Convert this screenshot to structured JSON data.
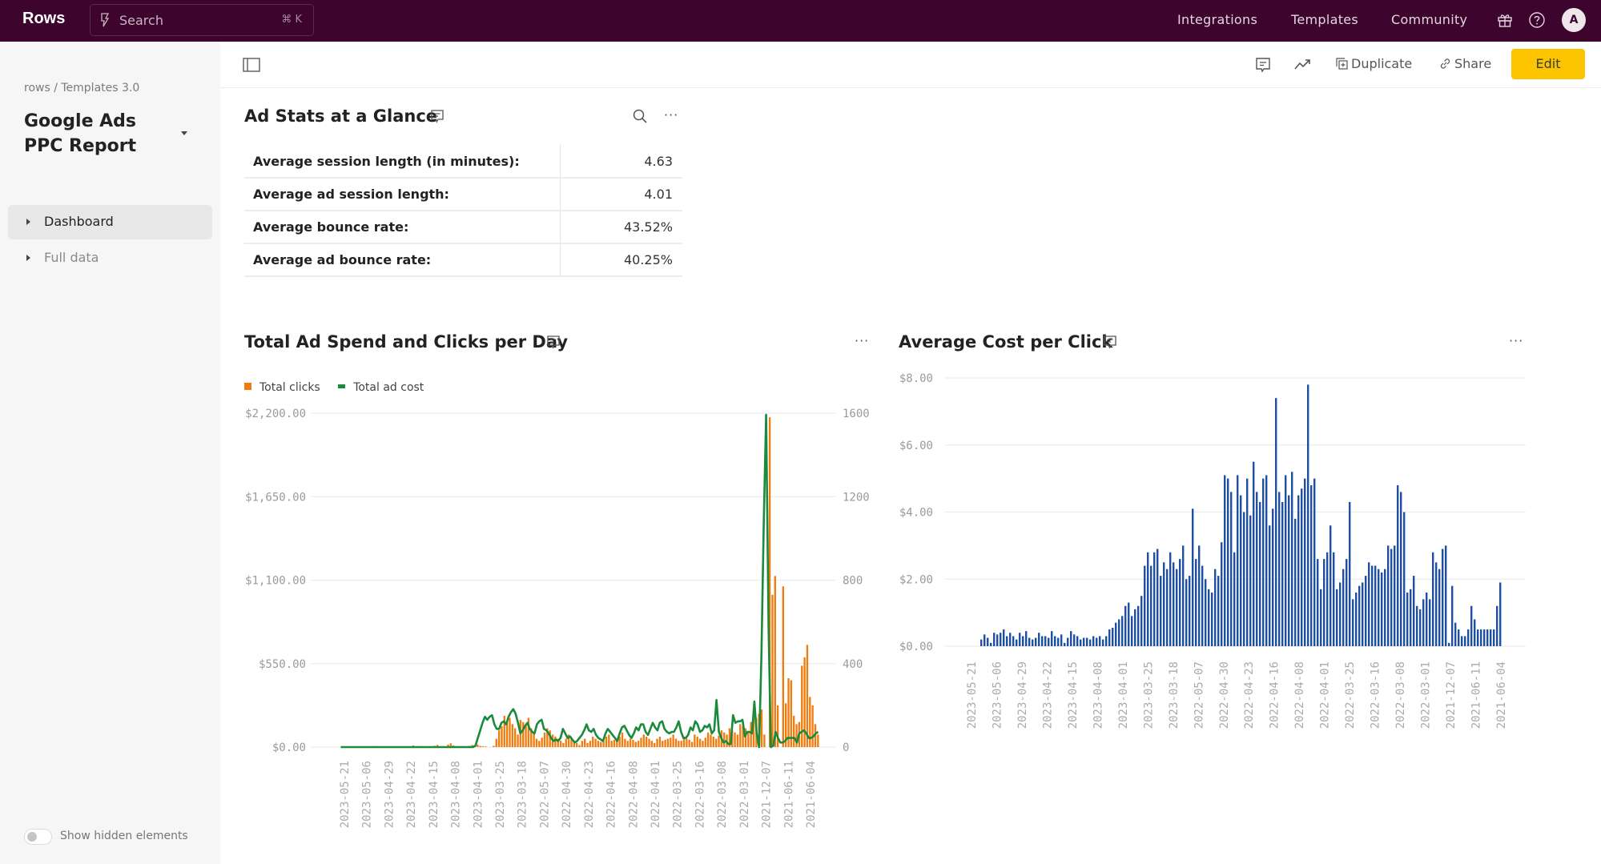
{
  "topbar": {
    "brand": "Rows",
    "search_placeholder": "Search",
    "search_shortcut": "⌘ K",
    "nav": [
      "Integrations",
      "Templates",
      "Community"
    ],
    "icons": [
      "gift-icon",
      "help-icon"
    ],
    "avatar_initial": "A",
    "colors": {
      "background": "#3d052d"
    }
  },
  "sidebar": {
    "breadcrumb": "rows / Templates 3.0",
    "doc_title": "Google Ads PPC Report",
    "items": [
      {
        "label": "Dashboard",
        "active": true
      },
      {
        "label": "Full data",
        "active": false
      }
    ],
    "toggle_label": "Show hidden elements",
    "toggle_on": false
  },
  "toolbar": {
    "duplicate_label": "Duplicate",
    "share_label": "Share",
    "edit_label": "Edit",
    "edit_color": "#fdc500"
  },
  "stats": {
    "title": "Ad Stats at a Glance",
    "rows": [
      {
        "label": "Average session length (in minutes):",
        "value": "4.63"
      },
      {
        "label": "Average ad session length:",
        "value": "4.01"
      },
      {
        "label": "Average bounce rate:",
        "value": "43.52%"
      },
      {
        "label": "Average ad bounce rate:",
        "value": "40.25%"
      }
    ]
  },
  "chart_data": [
    {
      "type": "bar",
      "title": "Total Ad Spend and Clicks per Day",
      "legend_position": "top-left",
      "legend": [
        "Total clicks",
        "Total ad cost"
      ],
      "colors": {
        "Total clicks": "#f07c0f",
        "Total ad cost": "#1a8a3c"
      },
      "y_left": {
        "ticks": [
          "$0.00",
          "$550.00",
          "$1,100.00",
          "$1,650.00",
          "$2,200.00"
        ],
        "range": [
          0,
          2200
        ]
      },
      "y_right": {
        "ticks": [
          "0",
          "400",
          "800",
          "1200",
          "1600"
        ],
        "range": [
          0,
          1600
        ]
      },
      "grid": true,
      "x_tick_labels": [
        "2023-05-21",
        "2023-05-06",
        "2023-04-29",
        "2023-04-22",
        "2023-04-15",
        "2023-04-08",
        "2023-04-01",
        "2023-03-25",
        "2023-03-18",
        "2022-05-07",
        "2022-04-30",
        "2022-04-23",
        "2022-04-16",
        "2022-04-08",
        "2022-04-01",
        "2022-03-25",
        "2022-03-16",
        "2022-03-08",
        "2022-03-01",
        "2021-12-07",
        "2021-06-11",
        "2021-06-04"
      ],
      "series": [
        {
          "name": "Total clicks",
          "kind": "bar",
          "axis": "right",
          "values": [
            0,
            0,
            2,
            1,
            3,
            2,
            1,
            0,
            2,
            3,
            2,
            1,
            4,
            2,
            3,
            2,
            1,
            2,
            3,
            1,
            2,
            0,
            1,
            3,
            2,
            1,
            2,
            8,
            3,
            2,
            4,
            2,
            1,
            3,
            2,
            6,
            10,
            4,
            2,
            3,
            12,
            18,
            8,
            3,
            2,
            5,
            3,
            2,
            6,
            10,
            8,
            12,
            6,
            4,
            3,
            0,
            0,
            6,
            40,
            80,
            100,
            150,
            120,
            140,
            110,
            90,
            60,
            130,
            120,
            110,
            140,
            90,
            70,
            40,
            30,
            45,
            70,
            90,
            80,
            60,
            50,
            40,
            30,
            20,
            40,
            60,
            40,
            30,
            20,
            10,
            30,
            40,
            20,
            30,
            50,
            40,
            30,
            25,
            30,
            50,
            60,
            30,
            35,
            40,
            50,
            70,
            40,
            30,
            40,
            35,
            25,
            30,
            45,
            60,
            50,
            40,
            30,
            20,
            40,
            50,
            30,
            35,
            40,
            45,
            60,
            40,
            30,
            30,
            50,
            40,
            35,
            25,
            60,
            50,
            40,
            30,
            45,
            70,
            60,
            50,
            40,
            55,
            80,
            70,
            60,
            90,
            80,
            70,
            60,
            110,
            100,
            90,
            70,
            120,
            150,
            140,
            160,
            180,
            60,
            0,
            1580,
            730,
            820,
            200,
            0,
            770,
            210,
            330,
            320,
            150,
            110,
            120,
            390,
            430,
            490,
            240,
            200,
            110,
            60
          ]
        },
        {
          "name": "Total ad cost",
          "kind": "line",
          "axis": "left",
          "values": [
            0,
            0,
            0,
            0,
            0,
            0,
            0,
            0,
            0,
            0,
            0,
            0,
            0,
            0,
            0,
            0,
            0,
            0,
            0,
            0,
            0,
            0,
            0,
            0,
            0,
            0,
            0,
            0,
            0,
            0,
            0,
            0,
            0,
            0,
            0,
            0,
            0,
            0,
            0,
            0,
            0,
            0,
            0,
            0,
            0,
            0,
            0,
            0,
            0,
            0,
            0,
            0,
            0,
            0,
            0,
            0,
            0,
            10,
            60,
            110,
            160,
            200,
            180,
            200,
            210,
            150,
            120,
            120,
            160,
            170,
            150,
            200,
            230,
            250,
            220,
            160,
            90,
            110,
            140,
            160,
            120,
            100,
            90,
            150,
            170,
            180,
            120,
            110,
            90,
            60,
            40,
            50,
            40,
            60,
            120,
            90,
            60,
            70,
            50,
            30,
            40,
            60,
            80,
            110,
            150,
            110,
            100,
            120,
            80,
            60,
            50,
            40,
            90,
            120,
            100,
            80,
            60,
            40,
            90,
            130,
            140,
            110,
            80,
            60,
            90,
            130,
            110,
            150,
            150,
            100,
            80,
            120,
            160,
            130,
            110,
            160,
            170,
            120,
            100,
            90,
            100,
            100,
            130,
            170,
            100,
            60,
            60,
            80,
            130,
            110,
            170,
            150,
            100,
            110,
            140,
            130,
            150,
            90,
            110,
            310,
            100,
            60,
            30,
            40,
            20,
            20,
            210,
            160,
            170,
            170,
            180,
            70,
            100,
            100,
            90,
            300,
            90,
            0,
            600,
            1500,
            2190,
            800,
            0,
            10,
            100,
            60,
            30,
            30,
            40,
            60,
            60,
            60,
            60,
            30,
            90,
            100,
            110,
            90,
            60,
            60,
            70,
            90,
            100
          ]
        }
      ]
    },
    {
      "type": "bar",
      "title": "Average Cost per Click",
      "color": "#1f4fa0",
      "y": {
        "ticks": [
          "$0.00",
          "$2.00",
          "$4.00",
          "$6.00",
          "$8.00"
        ],
        "range": [
          0,
          8
        ]
      },
      "grid": true,
      "x_tick_labels": [
        "2023-05-21",
        "2023-05-06",
        "2023-04-29",
        "2023-04-22",
        "2023-04-15",
        "2023-04-08",
        "2023-04-01",
        "2023-03-25",
        "2023-03-18",
        "2022-05-07",
        "2022-04-30",
        "2022-04-23",
        "2022-04-16",
        "2022-04-08",
        "2022-04-01",
        "2022-03-25",
        "2022-03-16",
        "2022-03-08",
        "2022-03-01",
        "2021-12-07",
        "2021-06-11",
        "2021-06-04"
      ],
      "values": [
        0.2,
        0.35,
        0.25,
        0.1,
        0.4,
        0.35,
        0.4,
        0.5,
        0.3,
        0.4,
        0.3,
        0.2,
        0.4,
        0.3,
        0.45,
        0.25,
        0.2,
        0.25,
        0.4,
        0.3,
        0.3,
        0.25,
        0.45,
        0.3,
        0.25,
        0.35,
        0.1,
        0.25,
        0.45,
        0.35,
        0.3,
        0.2,
        0.25,
        0.25,
        0.2,
        0.3,
        0.25,
        0.3,
        0.2,
        0.3,
        0.5,
        0.55,
        0.7,
        0.8,
        0.9,
        1.2,
        1.3,
        0.9,
        1.1,
        1.2,
        1.5,
        2.4,
        2.8,
        2.4,
        2.8,
        2.9,
        2.1,
        2.5,
        2.3,
        2.8,
        2.5,
        2.3,
        2.6,
        3.0,
        2.0,
        2.1,
        4.1,
        2.6,
        3.0,
        2.4,
        2.0,
        1.7,
        1.6,
        2.3,
        2.1,
        3.1,
        5.1,
        5.0,
        4.6,
        2.8,
        5.1,
        4.5,
        4.0,
        5.0,
        3.9,
        5.5,
        4.6,
        4.3,
        5.0,
        5.1,
        3.6,
        4.1,
        7.4,
        4.6,
        4.3,
        5.1,
        4.5,
        5.2,
        3.8,
        4.5,
        4.7,
        5.0,
        7.8,
        4.8,
        5.0,
        2.6,
        1.7,
        2.6,
        2.8,
        3.6,
        2.8,
        1.7,
        1.9,
        2.3,
        2.6,
        4.3,
        1.4,
        1.6,
        1.8,
        1.9,
        2.1,
        2.5,
        2.4,
        2.4,
        2.3,
        2.2,
        2.3,
        3.0,
        2.9,
        3.0,
        4.8,
        4.6,
        4.0,
        1.6,
        1.7,
        2.1,
        1.2,
        1.1,
        1.4,
        1.6,
        1.4,
        2.8,
        2.5,
        2.3,
        2.9,
        3.0,
        0.1,
        1.8,
        0.7,
        0.5,
        0.3,
        0.3,
        0.5,
        1.2,
        0.8,
        0.5,
        0.5,
        0.5,
        0.5,
        0.5,
        0.5,
        1.2,
        1.9
      ]
    }
  ]
}
